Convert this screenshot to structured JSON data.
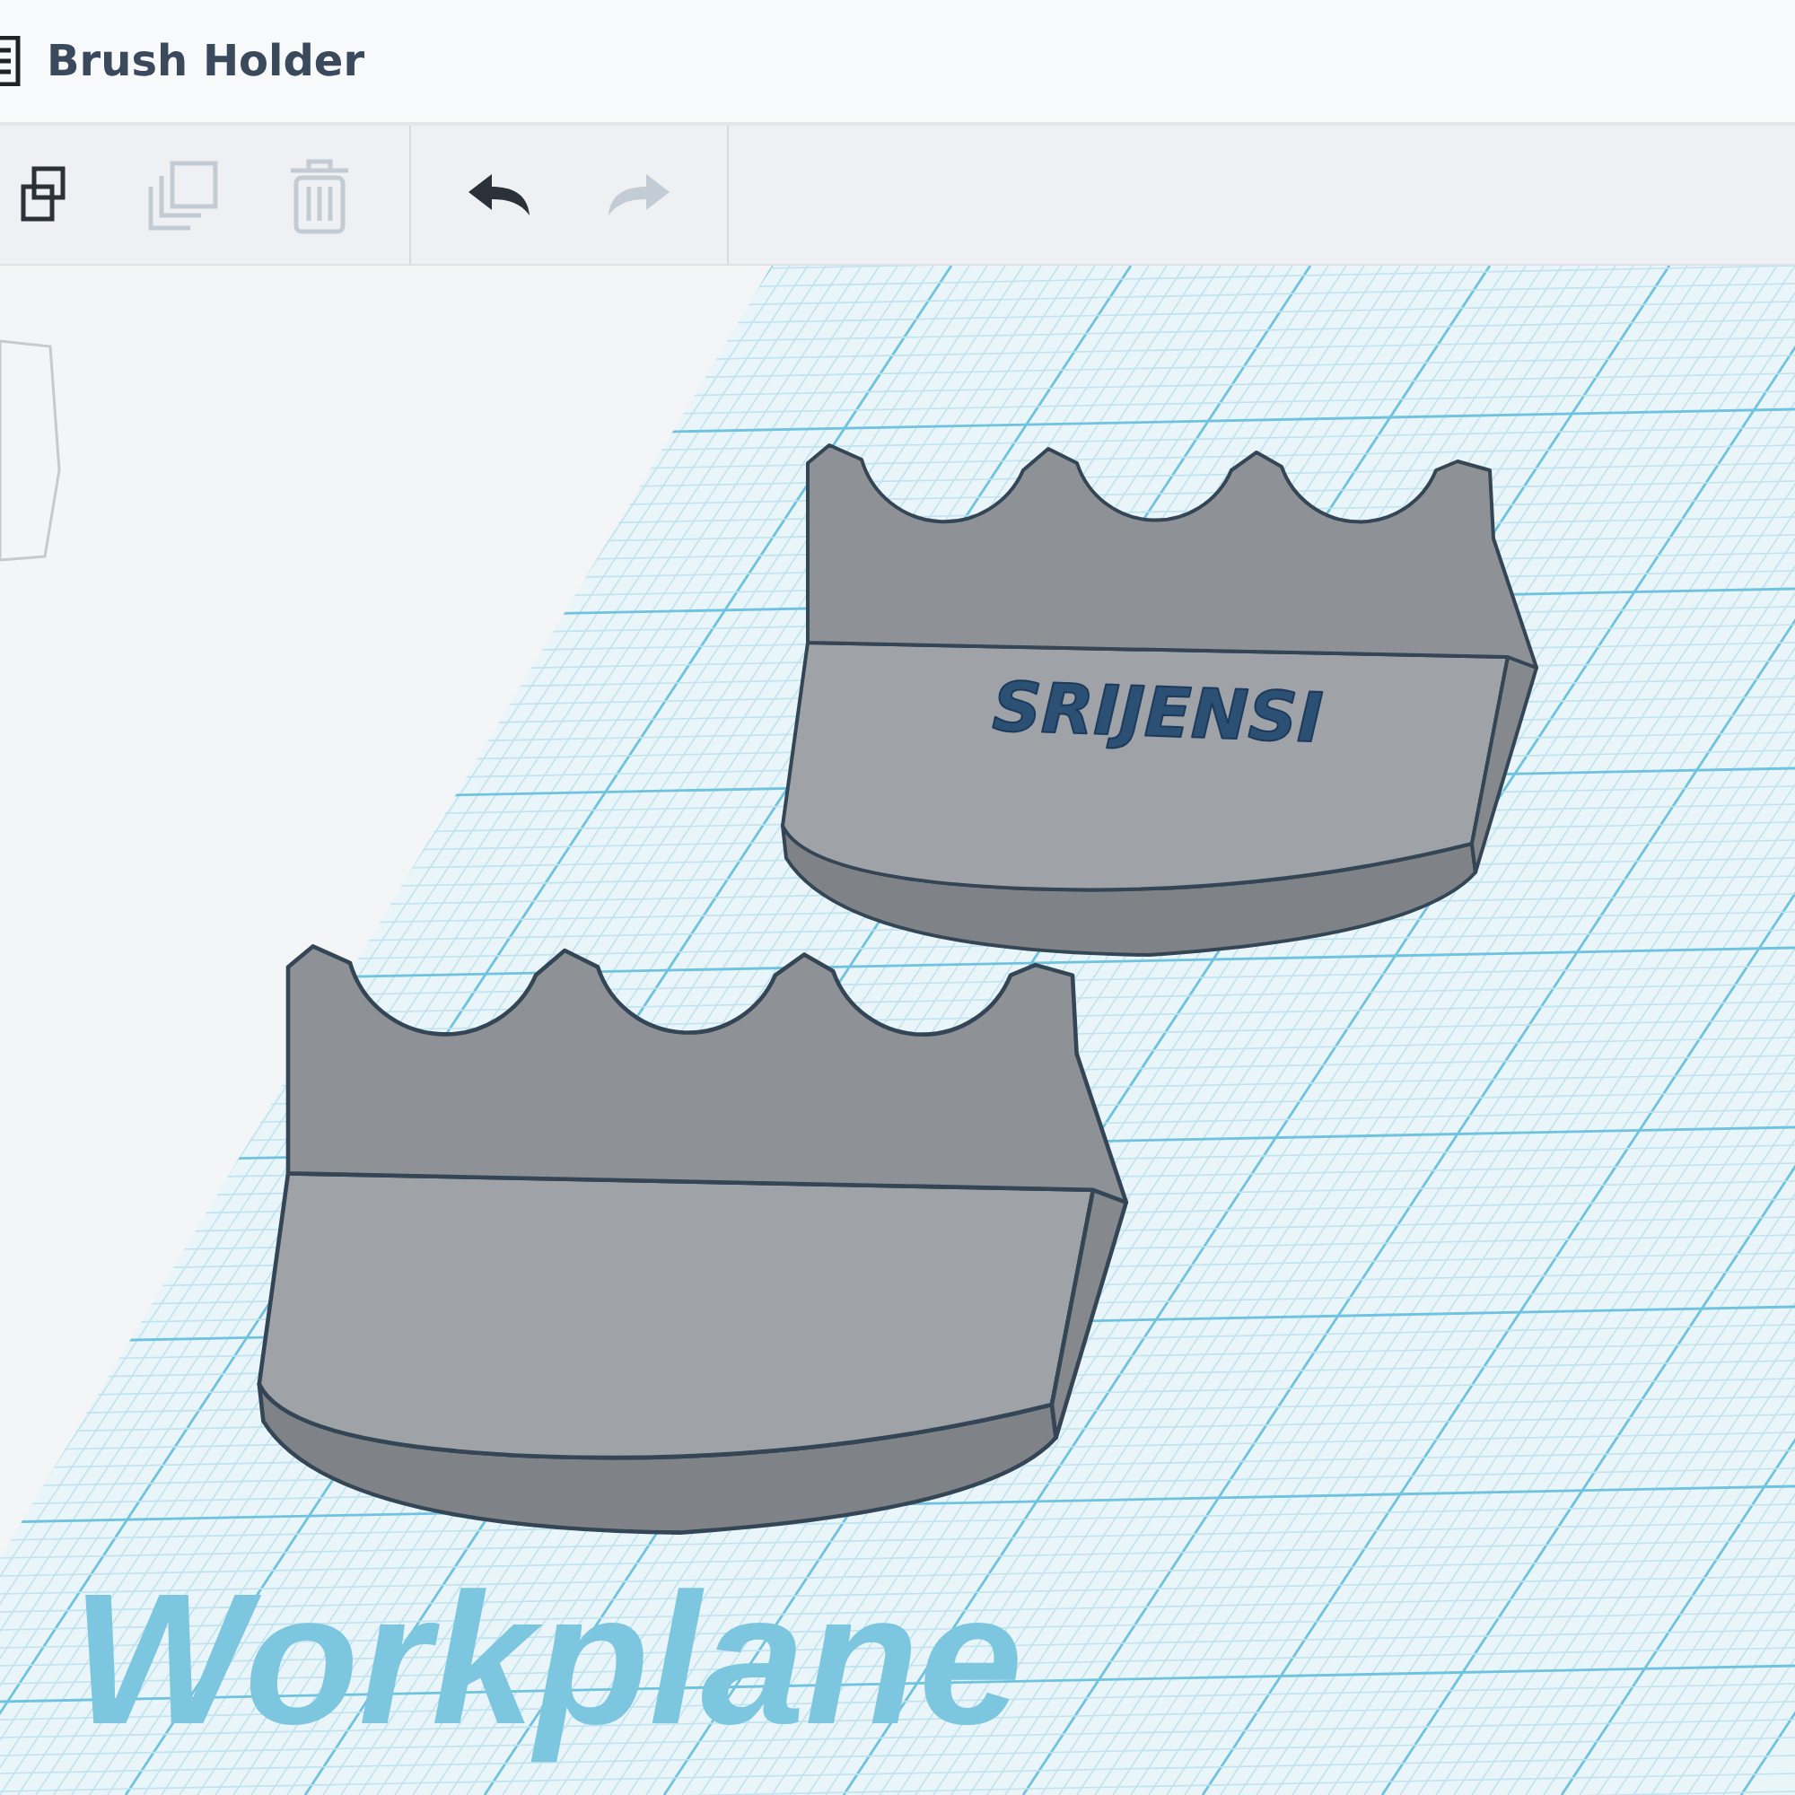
{
  "title_bar": {
    "title": "Brush Holder"
  },
  "toolbar": {
    "groups": [
      [
        {
          "kind": "copy",
          "disabled": false
        },
        {
          "kind": "duplicate",
          "disabled": true
        },
        {
          "kind": "delete",
          "disabled": true
        }
      ],
      [
        {
          "kind": "undo",
          "disabled": false
        },
        {
          "kind": "redo",
          "disabled": true
        }
      ]
    ]
  },
  "viewport": {
    "models": [
      {
        "kind": "engraved",
        "engraving": "SRIJENSI"
      },
      {
        "kind": "plain"
      }
    ],
    "workplane_label": "Workplane"
  }
}
